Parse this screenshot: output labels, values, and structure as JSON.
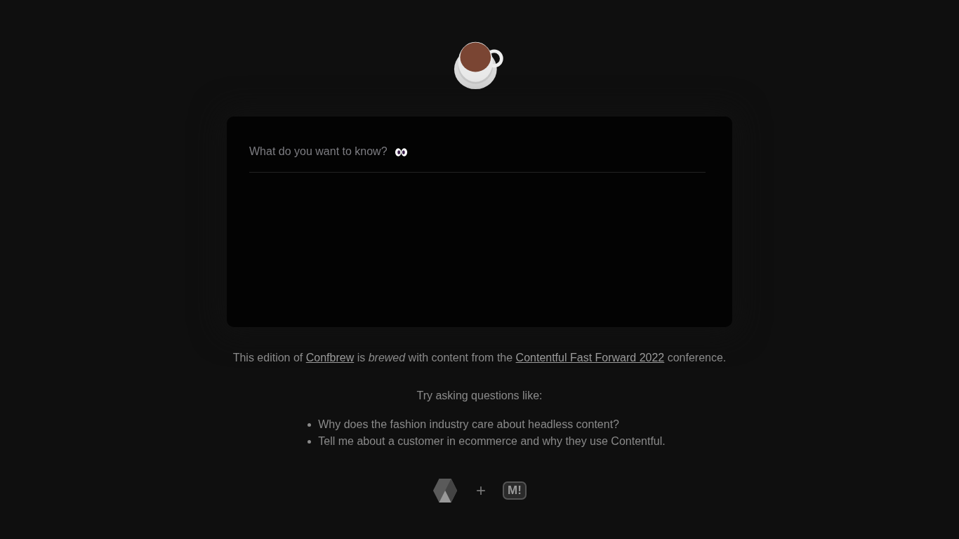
{
  "question": {
    "placeholder": "What do you want to know?"
  },
  "intro": [
    {
      "kind": "text",
      "text": "This edition of "
    },
    {
      "kind": "link",
      "text": "Confbrew"
    },
    {
      "kind": "text",
      "text": " is *brewed* with content from the "
    },
    {
      "kind": "link",
      "text": "Contentful Fast Forward 2022"
    },
    {
      "kind": "text",
      "text": " conference."
    }
  ],
  "suggestions": {
    "heading": "Try asking questions like:",
    "items": [
      "Why does the fashion industry care about headless content?",
      "Tell me about a customer in ecommerce and why they use Contentful."
    ]
  },
  "footer": {
    "plus": "+",
    "badge": "M!"
  }
}
